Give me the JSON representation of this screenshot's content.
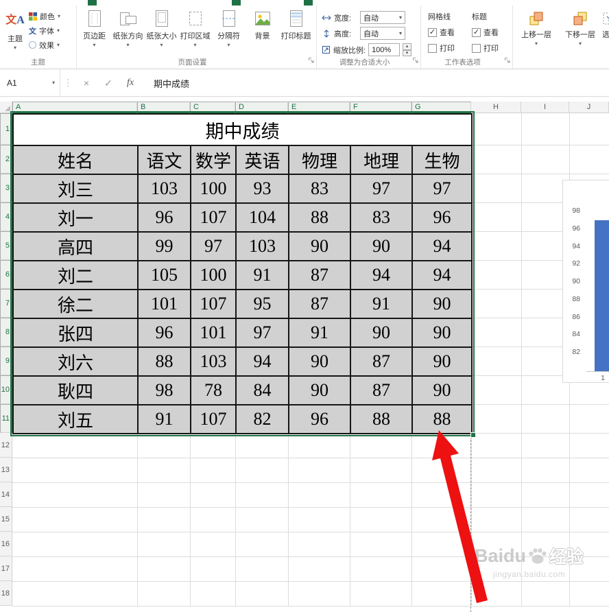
{
  "icons": {
    "dropdown": "▾",
    "check": "✓",
    "spinner_up": "▴",
    "spinner_down": "▾",
    "handle_dots": "⋮"
  },
  "ribbon": {
    "themes": {
      "group_label": "主题",
      "theme_button": "主题",
      "colors_button": "颜色",
      "fonts_button": "字体",
      "effects_button": "效果"
    },
    "page_setup": {
      "group_label": "页面设置",
      "buttons": [
        "页边距",
        "纸张方向",
        "纸张大小",
        "打印区域",
        "分隔符",
        "背景",
        "打印标题"
      ]
    },
    "scale_to_fit": {
      "group_label": "调整为合适大小",
      "width_label": "宽度:",
      "width_value": "自动",
      "height_label": "高度:",
      "height_value": "自动",
      "scale_label": "缩放比例:",
      "scale_value": "100%"
    },
    "sheet_options": {
      "group_label": "工作表选项",
      "gridlines_label": "网格线",
      "headings_label": "标题",
      "gridlines_view": {
        "label": "查看",
        "checked": true
      },
      "gridlines_print": {
        "label": "打印",
        "checked": false
      },
      "headings_view": {
        "label": "查看",
        "checked": true
      },
      "headings_print": {
        "label": "打印",
        "checked": false
      }
    },
    "arrange": {
      "bring_forward": "上移一层",
      "send_backward": "下移一层",
      "selection_pane_partial": "选"
    }
  },
  "formula_bar": {
    "name_box": "A1",
    "cancel": "×",
    "enter": "✓",
    "insert_function": "fx",
    "content": "期中成绩"
  },
  "grid": {
    "column_headers": [
      "A",
      "B",
      "C",
      "D",
      "E",
      "F",
      "G",
      "H",
      "I",
      "J"
    ],
    "selected_columns": [
      "A",
      "B",
      "C",
      "D",
      "E",
      "F",
      "G"
    ],
    "row_headers": [
      "1",
      "2",
      "3",
      "4",
      "5",
      "6",
      "7",
      "8",
      "9",
      "10",
      "11",
      "12",
      "13",
      "14",
      "15",
      "16",
      "17",
      "18"
    ],
    "selected_rows_count": 11
  },
  "table": {
    "title": "期中成绩",
    "headers": [
      "姓名",
      "语文",
      "数学",
      "英语",
      "物理",
      "地理",
      "生物"
    ],
    "rows": [
      [
        "刘三",
        103,
        100,
        93,
        83,
        97,
        97
      ],
      [
        "刘一",
        96,
        107,
        104,
        88,
        83,
        96
      ],
      [
        "高四",
        99,
        97,
        103,
        90,
        90,
        94
      ],
      [
        "刘二",
        105,
        100,
        91,
        87,
        94,
        94
      ],
      [
        "徐二",
        101,
        107,
        95,
        87,
        91,
        90
      ],
      [
        "张四",
        96,
        101,
        97,
        91,
        90,
        90
      ],
      [
        "刘六",
        88,
        103,
        94,
        90,
        87,
        90
      ],
      [
        "耿四",
        98,
        78,
        84,
        90,
        87,
        90
      ],
      [
        "刘五",
        91,
        107,
        82,
        96,
        88,
        88
      ]
    ]
  },
  "chart_data": {
    "type": "bar",
    "partially_visible": true,
    "visible_y_ticks": [
      98,
      96,
      94,
      92,
      90,
      88,
      86,
      84,
      82
    ],
    "visible_x_labels": [
      "1"
    ],
    "visible_bars": [
      {
        "x": "1",
        "value_estimate": 97
      }
    ],
    "bar_color": "#4472C4"
  },
  "watermark": {
    "brand": "Baidu",
    "brand_suffix": "经验",
    "url": "jingyan.baidu.com"
  },
  "colors": {
    "excel_green": "#217346",
    "selection_fill": "#d1d1d1",
    "arrow_red": "#ed1111"
  }
}
